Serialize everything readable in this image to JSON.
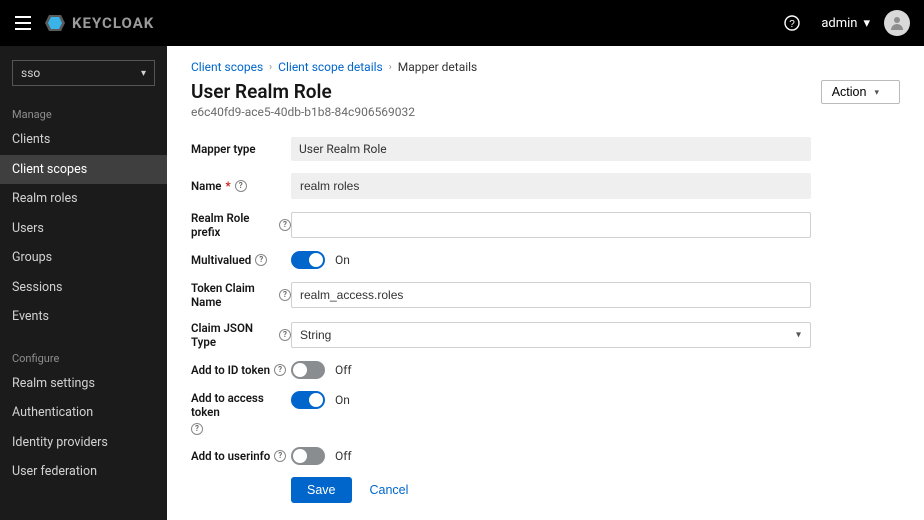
{
  "topbar": {
    "brand": "KEYCLOAK",
    "user_label": "admin"
  },
  "sidebar": {
    "realm_selected": "sso",
    "section_manage": "Manage",
    "section_configure": "Configure",
    "manage_items": [
      {
        "label": "Clients"
      },
      {
        "label": "Client scopes"
      },
      {
        "label": "Realm roles"
      },
      {
        "label": "Users"
      },
      {
        "label": "Groups"
      },
      {
        "label": "Sessions"
      },
      {
        "label": "Events"
      }
    ],
    "configure_items": [
      {
        "label": "Realm settings"
      },
      {
        "label": "Authentication"
      },
      {
        "label": "Identity providers"
      },
      {
        "label": "User federation"
      }
    ],
    "active": "Client scopes"
  },
  "breadcrumb": {
    "items": [
      {
        "label": "Client scopes",
        "link": true
      },
      {
        "label": "Client scope details",
        "link": true
      },
      {
        "label": "Mapper details",
        "link": false
      }
    ]
  },
  "page": {
    "title": "User Realm Role",
    "subtitle": "e6c40fd9-ace5-40db-b1b8-84c906569032",
    "action_label": "Action"
  },
  "form": {
    "labels": {
      "mapper_type": "Mapper type",
      "name": "Name",
      "realm_role_prefix": "Realm Role prefix",
      "multivalued": "Multivalued",
      "token_claim_name": "Token Claim Name",
      "claim_json_type": "Claim JSON Type",
      "add_to_id_token": "Add to ID token",
      "add_to_access_token": "Add to access token",
      "add_to_userinfo": "Add to userinfo"
    },
    "values": {
      "mapper_type": "User Realm Role",
      "name": "realm roles",
      "realm_role_prefix": "",
      "multivalued": "On",
      "token_claim_name": "realm_access.roles",
      "claim_json_type": "String",
      "add_to_id_token": "Off",
      "add_to_access_token": "On",
      "add_to_userinfo": "Off"
    },
    "switch_on_text": "On",
    "switch_off_text": "Off",
    "save_label": "Save",
    "cancel_label": "Cancel"
  }
}
